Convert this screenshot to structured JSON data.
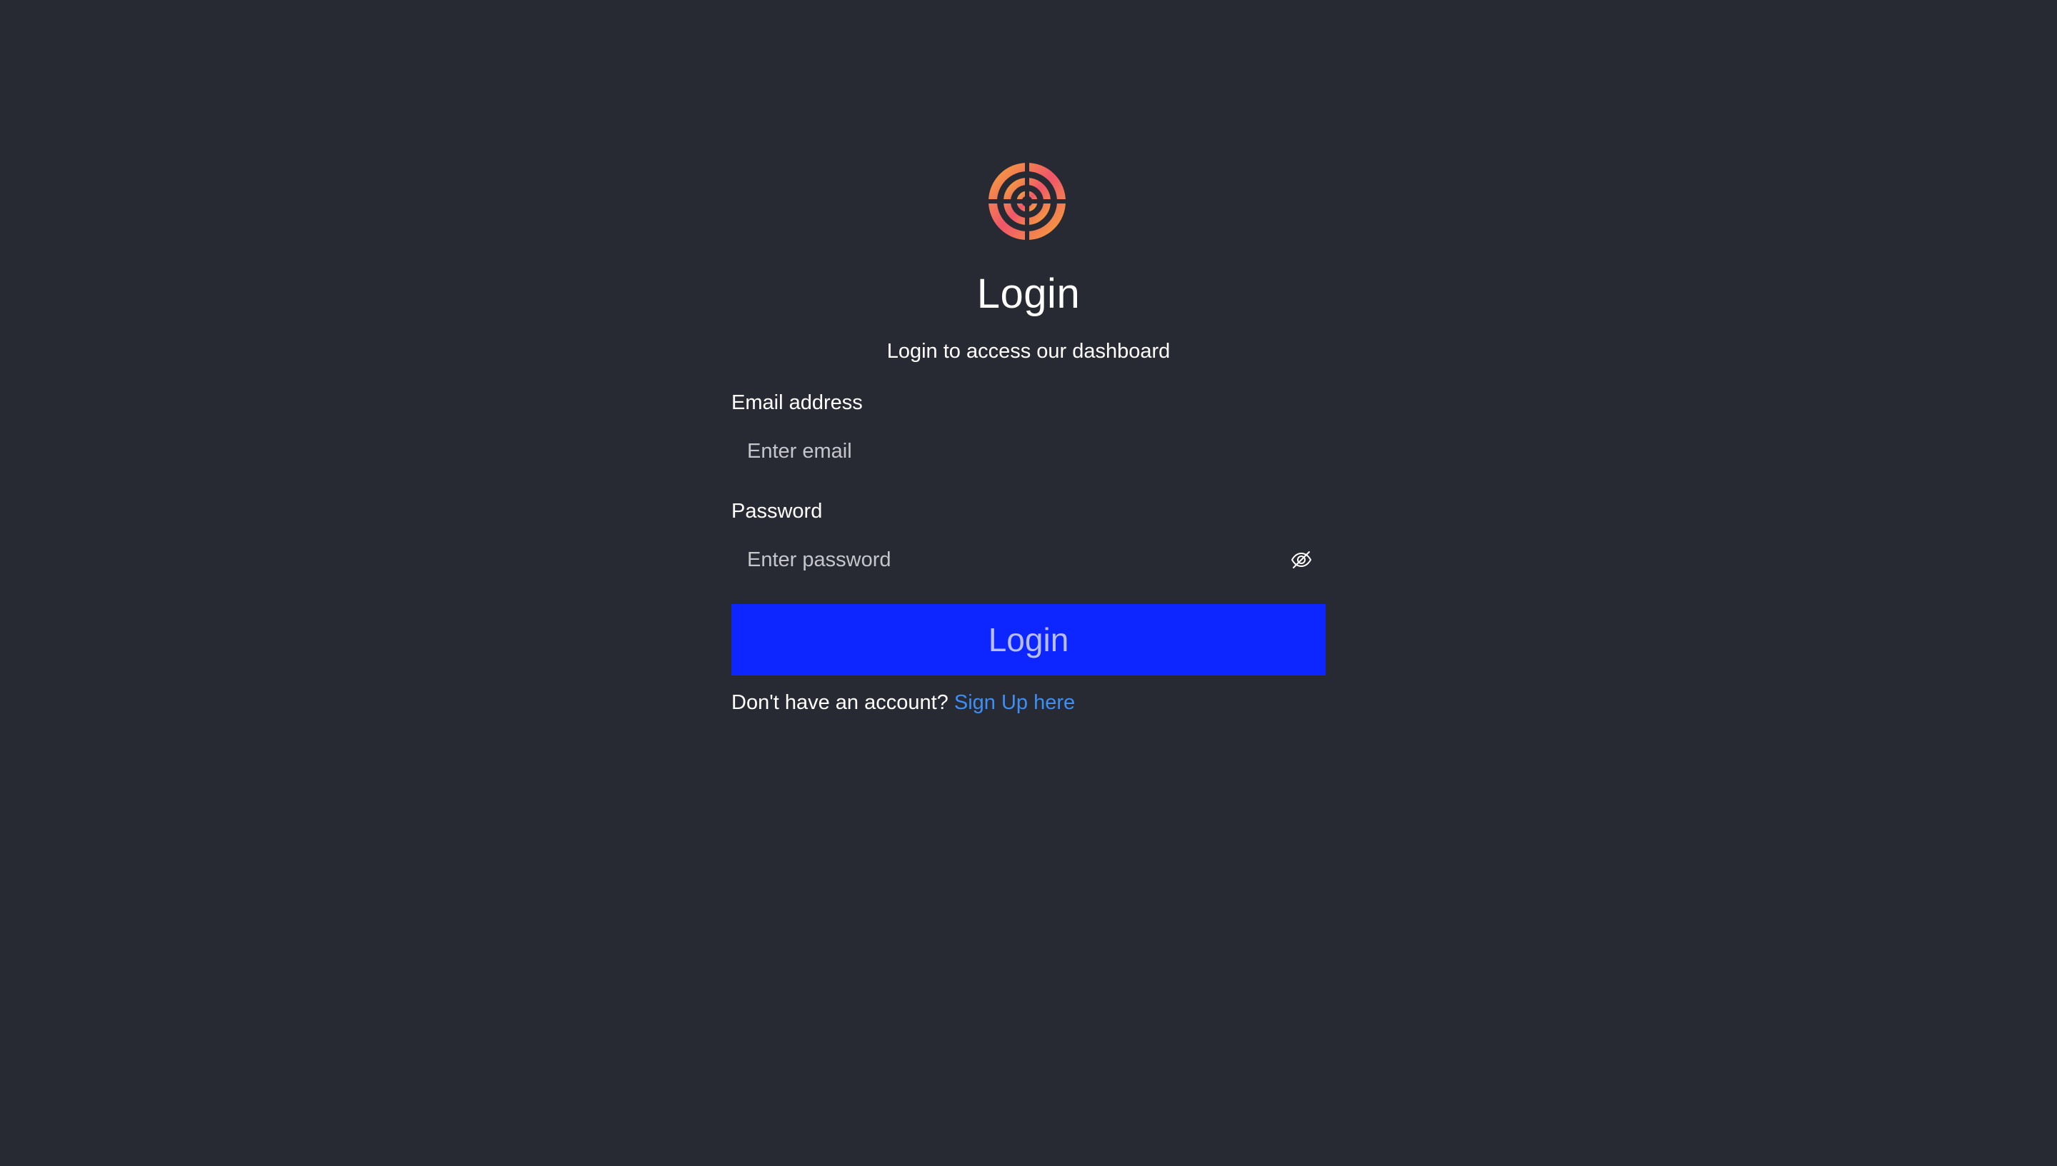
{
  "logo": {
    "icon": "target-logo-icon",
    "colors": [
      "#f0556a",
      "#f5a03c"
    ]
  },
  "header": {
    "title": "Login",
    "subtitle": "Login to access our dashboard"
  },
  "form": {
    "email_label": "Email address",
    "email_placeholder": "Enter email",
    "email_value": "",
    "password_label": "Password",
    "password_placeholder": "Enter password",
    "password_value": "",
    "password_toggle_icon": "eye-slash-icon",
    "submit_label": "Login"
  },
  "footer": {
    "prompt": "Don't have an account?",
    "link_label": "Sign Up here"
  },
  "colors": {
    "background": "#272a33",
    "button": "#0d25ff",
    "button_text": "#b6bdf6",
    "link": "#3d8ef5"
  }
}
